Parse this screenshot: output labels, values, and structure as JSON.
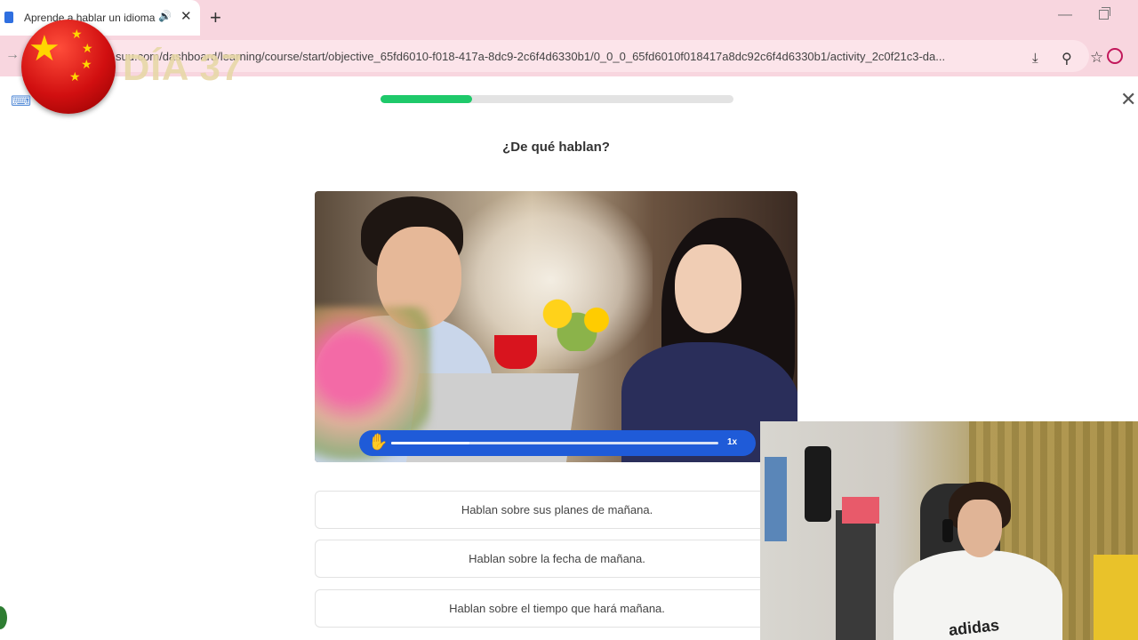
{
  "browser": {
    "tab_title": "Aprende a hablar un idioma",
    "tab_audio_icon": "speaker-icon",
    "new_tab_label": "+",
    "close_tab_label": "✕",
    "url": "suu.com/dashboard/learning/course/start/objective_65fd6010-f018-417a-8dc9-2c6f4d6330b1/0_0_0_65fd6010f018417a8dc92c6f4d6330b1/activity_2c0f21c3-da..."
  },
  "overlay": {
    "day_label": "DÍA 37"
  },
  "lesson": {
    "progress": 0.26,
    "question": "¿De qué hablan?",
    "audio": {
      "progress": 0.24,
      "speed": "1x"
    },
    "options": [
      "Hablan sobre sus planes de mañana.",
      "Hablan sobre la fecha de mañana.",
      "Hablan sobre el tiempo que hará mañana."
    ]
  },
  "webcam": {
    "shirt_logo": "adidas"
  },
  "colors": {
    "accent_green": "#1ec96a",
    "player_blue": "#1f5bd8",
    "browser_chrome": "#f8d6df"
  }
}
